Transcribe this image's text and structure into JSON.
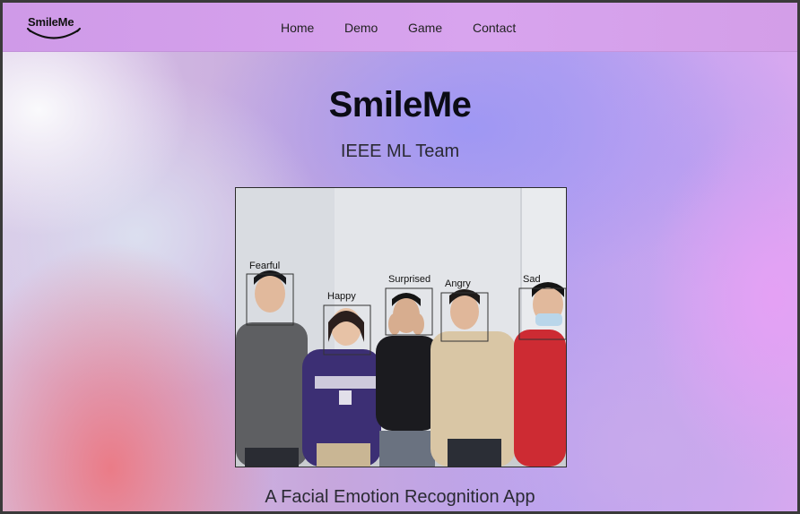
{
  "nav": {
    "logo_text": "SmileMe",
    "links": [
      "Home",
      "Demo",
      "Game",
      "Contact"
    ]
  },
  "hero": {
    "title": "SmileMe",
    "subtitle": "IEEE ML Team",
    "tagline": "A Facial Emotion Recognition App"
  },
  "photo": {
    "emotion_labels": [
      "Fearful",
      "Happy",
      "Surprised",
      "Angry",
      "Sad"
    ]
  },
  "colors": {
    "navbar": "#d8a4ee",
    "title": "#0b0b14"
  }
}
